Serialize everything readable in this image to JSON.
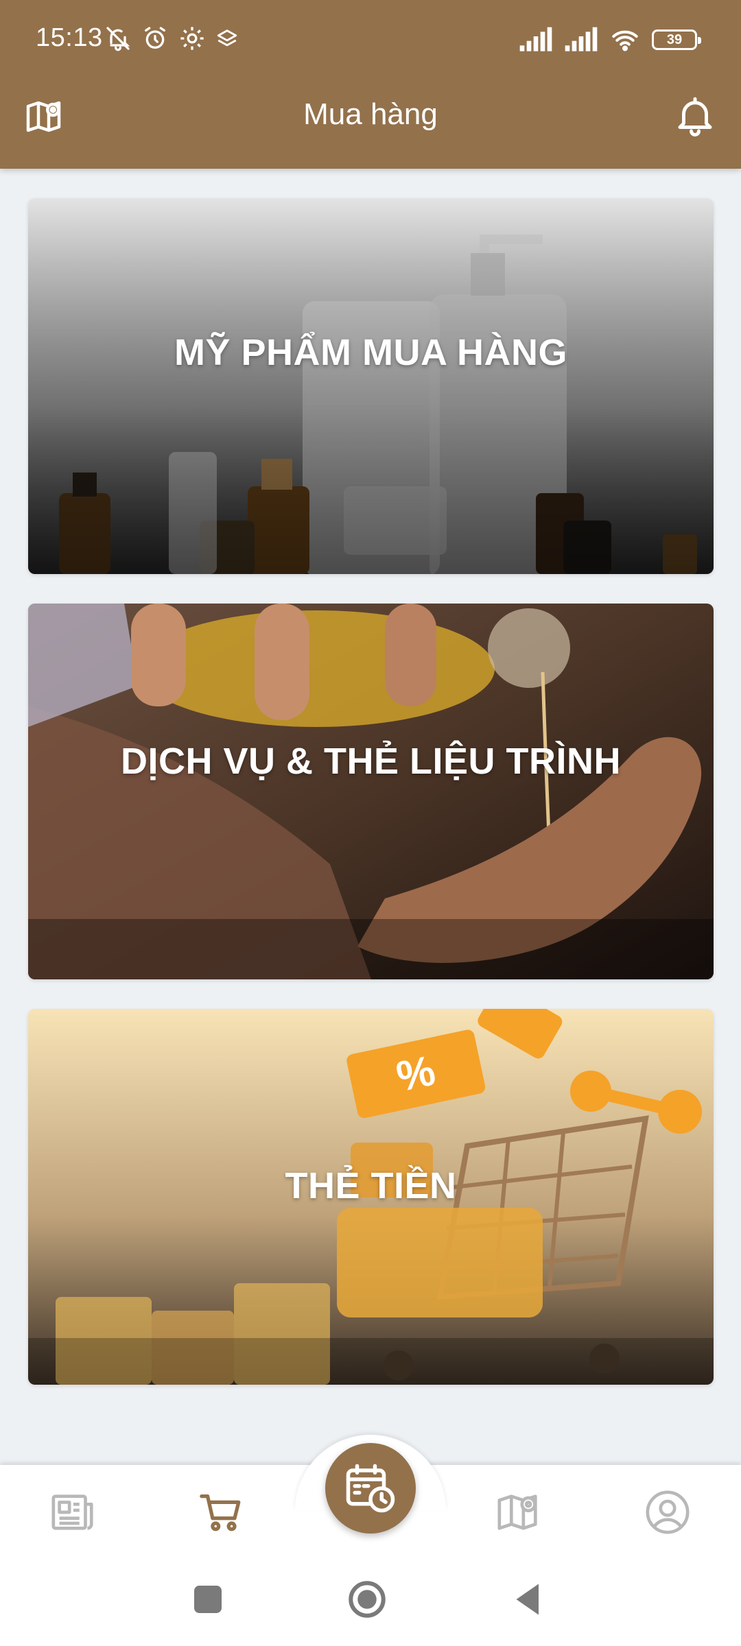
{
  "status_bar": {
    "time": "15:13",
    "battery": "39",
    "left_icons": [
      "notifications-off-icon",
      "alarm-icon",
      "settings-gear-icon",
      "layers-icon"
    ],
    "right_icons": [
      "signal-icon",
      "signal-icon",
      "wifi-icon",
      "battery-icon"
    ]
  },
  "app_bar": {
    "title": "Mua hàng",
    "left_icon": "map-pin-icon",
    "right_icon": "bell-icon"
  },
  "cards": [
    {
      "label": "MỸ PHẨM MUA HÀNG",
      "image": "cosmetic-bottles-image"
    },
    {
      "label": "DỊCH VỤ & THẺ LIỆU TRÌNH",
      "image": "oil-pouring-hand-image"
    },
    {
      "label": "THẺ TIỀN",
      "image": "shopping-cart-coupon-image"
    }
  ],
  "bottom_nav": {
    "items": [
      {
        "icon": "newspaper-icon",
        "active": false
      },
      {
        "icon": "cart-icon",
        "active": true
      },
      {
        "icon": "calendar-clock-icon",
        "active": false,
        "center": true
      },
      {
        "icon": "map-pin-icon",
        "active": false
      },
      {
        "icon": "profile-icon",
        "active": false
      }
    ]
  },
  "system_nav": [
    "recent-apps-icon",
    "home-icon",
    "back-icon"
  ],
  "colors": {
    "primary": "#93714b",
    "background": "#eef1f4",
    "nav_inactive": "#b8b8b8",
    "nav_active": "#93714b"
  }
}
